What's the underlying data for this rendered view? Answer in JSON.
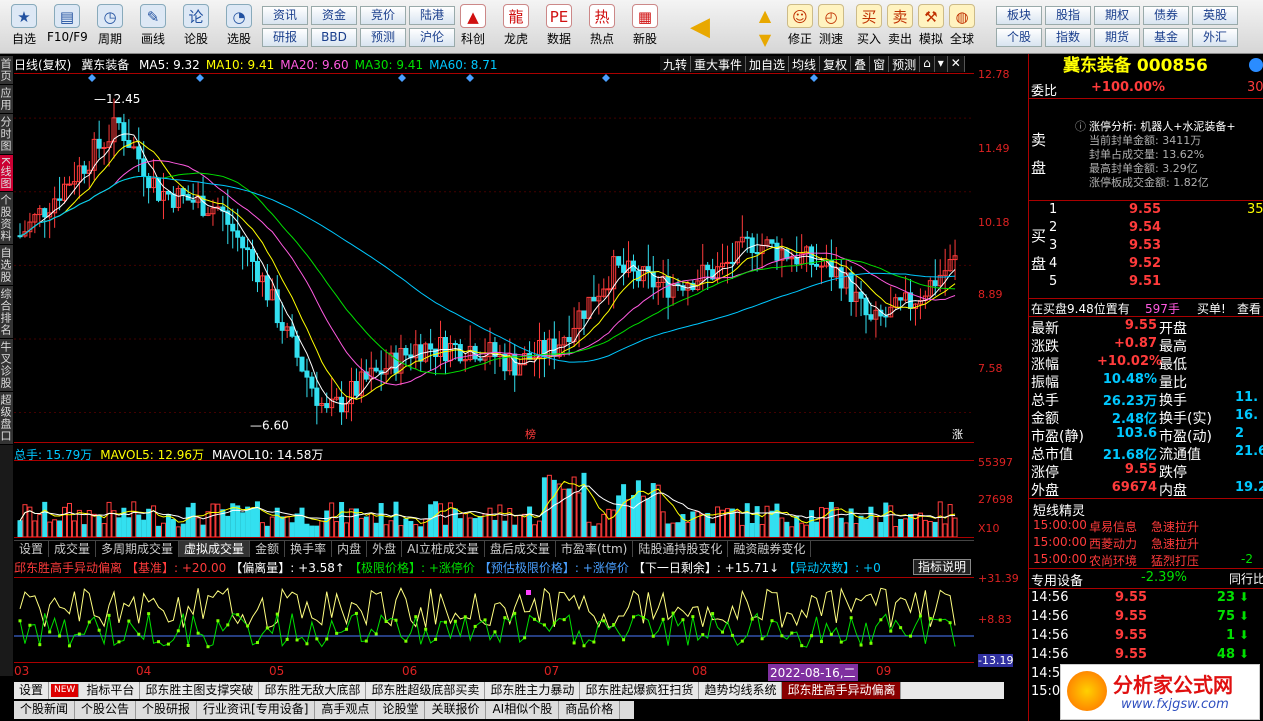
{
  "toolbar": {
    "left": [
      {
        "label": "自选",
        "icon": "star-icon"
      },
      {
        "label": "F10/F9",
        "icon": "document-icon"
      },
      {
        "label": "周期",
        "icon": "clock-icon"
      },
      {
        "label": "画线",
        "icon": "pen-icon"
      },
      {
        "label": "论股",
        "icon": "chat-icon"
      },
      {
        "label": "选股",
        "icon": "chart-search-icon"
      }
    ],
    "grid1": [
      "资讯",
      "资金",
      "竞价",
      "陆港",
      "研报",
      "BBD",
      "预测",
      "沪伦"
    ],
    "mid": [
      {
        "label": "科创",
        "icon": "rocket-icon"
      },
      {
        "label": "龙虎",
        "icon": "dragon-icon"
      },
      {
        "label": "数据",
        "icon": "pe-icon"
      },
      {
        "label": "热点",
        "icon": "hot-icon"
      },
      {
        "label": "新股",
        "icon": "newstock-icon"
      }
    ],
    "right": [
      {
        "label": "修正",
        "icon": "smile-icon"
      },
      {
        "label": "测速",
        "icon": "timer-icon"
      },
      {
        "label": "买入",
        "icon": "buy-icon"
      },
      {
        "label": "卖出",
        "icon": "sell-icon"
      },
      {
        "label": "模拟",
        "icon": "hammer-icon"
      },
      {
        "label": "全球",
        "icon": "globe-icon"
      }
    ],
    "grid2": [
      "板块",
      "股指",
      "期权",
      "债券",
      "英股",
      "个股",
      "指数",
      "期货",
      "基金",
      "外汇"
    ]
  },
  "left_tabs": [
    "首页",
    "应用",
    "分时图",
    "K线图",
    "个股资料",
    "自选股",
    "综合排名",
    "牛叉诊股",
    "超级盘口"
  ],
  "chart": {
    "mode": "日线(复权)",
    "name": "冀东装备",
    "ma": [
      {
        "t": "MA5: 9.32",
        "c": "#ffffff"
      },
      {
        "t": "MA10: 9.41",
        "c": "#ffff00"
      },
      {
        "t": "MA20: 9.60",
        "c": "#ff5ae0"
      },
      {
        "t": "MA30: 9.41",
        "c": "#00e000"
      },
      {
        "t": "MA60: 8.71",
        "c": "#00c8ff"
      }
    ],
    "top_buttons": [
      "九转",
      "重大事件",
      "加自选",
      "均线",
      "复权",
      "叠",
      "窗",
      "预测",
      "⌂",
      "▾",
      "✕"
    ],
    "y_labels": [
      "12.78",
      "11.49",
      "10.18",
      "8.89",
      "7.58"
    ],
    "hi": "12.45",
    "lo": "6.60",
    "tag1": "榜",
    "tag2": "涨"
  },
  "volume": {
    "head": [
      {
        "t": "总手: 15.79万",
        "c": "#00c8ff"
      },
      {
        "t": "MAVOL5: 12.96万",
        "c": "#ffff00"
      },
      {
        "t": "MAVOL10: 14.58万",
        "c": "#ffffff"
      }
    ],
    "y": [
      "55397",
      "27698",
      "X10"
    ]
  },
  "ind_tabs": [
    "设置",
    "成交量",
    "多周期成交量",
    "虚拟成交量",
    "金额",
    "换手率",
    "内盘",
    "外盘",
    "AI立桩成交量",
    "盘后成交量",
    "市盈率(ttm)",
    "陆股通持股变化",
    "融资融券变化"
  ],
  "ind_head": [
    {
      "t": "邱东胜高手异动偏离",
      "c": "#ff3b3b"
    },
    {
      "t": "【基准】: +20.00",
      "c": "#ff3b3b"
    },
    {
      "t": "【偏离量】: +3.58↑",
      "c": "#ffffff"
    },
    {
      "t": "【极限价格】: +涨停价",
      "c": "#00e000"
    },
    {
      "t": "【预估极限价格】: +涨停价",
      "c": "#4aa0ff"
    },
    {
      "t": "【下一日剩余】: +15.71↓",
      "c": "#ffffff"
    },
    {
      "t": "【异动次数】: +0",
      "c": "#00c8ff"
    }
  ],
  "ind_button": "指标说明",
  "ind_y": [
    "+31.39",
    "+8.83",
    "-13.19"
  ],
  "months": [
    "03",
    "04",
    "05",
    "06",
    "07",
    "08",
    "09"
  ],
  "date_tag": "2022-08-16,二",
  "bottom_tabs": [
    "设置",
    "NEW",
    "指标平台",
    "邱东胜主图支撑突破",
    "邱东胜无敌大底部",
    "邱东胜超级底部买卖",
    "邱东胜主力暴动",
    "邱东胜起爆疯狂扫货",
    "趋势均线系统",
    "邱东胜高手异动偏离"
  ],
  "bottom_tabs2": [
    "个股新闻",
    "个股公告",
    "个股研报",
    "行业资讯[专用设备]",
    "高手观点",
    "论股堂",
    "关联报价",
    "AI相似个股",
    "商品价格"
  ],
  "right": {
    "title": "冀东装备 000856",
    "weibi_label": "委比",
    "weibi": "+100.00%",
    "weibi_extra": "30",
    "sell_label": "卖盘",
    "limit_lines": [
      "涨停分析: 机器人+水泥装备+",
      "当前封单金额: 3411万",
      "封单占成交量: 13.62%",
      "最高封单金额: 3.29亿",
      "涨停板成交金额: 1.82亿"
    ],
    "buy_label": "买盘",
    "bids": [
      {
        "n": "1",
        "p": "9.55",
        "v": "35"
      },
      {
        "n": "2",
        "p": "9.54",
        "v": ""
      },
      {
        "n": "3",
        "p": "9.53",
        "v": ""
      },
      {
        "n": "4",
        "p": "9.52",
        "v": ""
      },
      {
        "n": "5",
        "p": "9.51",
        "v": ""
      }
    ],
    "queue": "在买盘9.48位置有",
    "queue_v": "597手",
    "queue_b": "买单!",
    "queue_c": "查看",
    "stats": [
      [
        "最新",
        "9.55",
        "开盘",
        ""
      ],
      [
        "涨跌",
        "+0.87",
        "最高",
        ""
      ],
      [
        "涨幅",
        "+10.02%",
        "最低",
        ""
      ],
      [
        "振幅",
        "10.48%",
        "量比",
        ""
      ],
      [
        "总手",
        "26.23万",
        "换手",
        "11."
      ],
      [
        "金额",
        "2.48亿",
        "换手(实)",
        "16."
      ],
      [
        "市盈(静)",
        "103.6",
        "市盈(动)",
        "2"
      ],
      [
        "总市值",
        "21.68亿",
        "流通值",
        "21.6"
      ],
      [
        "涨停",
        "9.55",
        "跌停",
        ""
      ],
      [
        "外盘",
        "69674",
        "内盘",
        "19.2"
      ]
    ],
    "sprite_title": "短线精灵",
    "sprites": [
      [
        "15:00:00",
        "卓易信息",
        "急速拉升",
        ""
      ],
      [
        "15:00:00",
        "西菱动力",
        "急速拉升",
        ""
      ],
      [
        "15:00:00",
        "农尚环境",
        "猛烈打压",
        "-2"
      ]
    ],
    "sector": "专用设备",
    "sector_pct": "-2.39%",
    "sector_btn": "同行比比",
    "ticks": [
      [
        "14:56",
        "9.55",
        "23"
      ],
      [
        "14:56",
        "9.55",
        "75"
      ],
      [
        "14:56",
        "9.55",
        "1"
      ],
      [
        "14:56",
        "9.55",
        "48"
      ]
    ],
    "tick_side": [
      "14:5",
      "15:0"
    ]
  },
  "watermark": {
    "cn": "分析家公式网",
    "url": "www.fxjgsw.com"
  }
}
